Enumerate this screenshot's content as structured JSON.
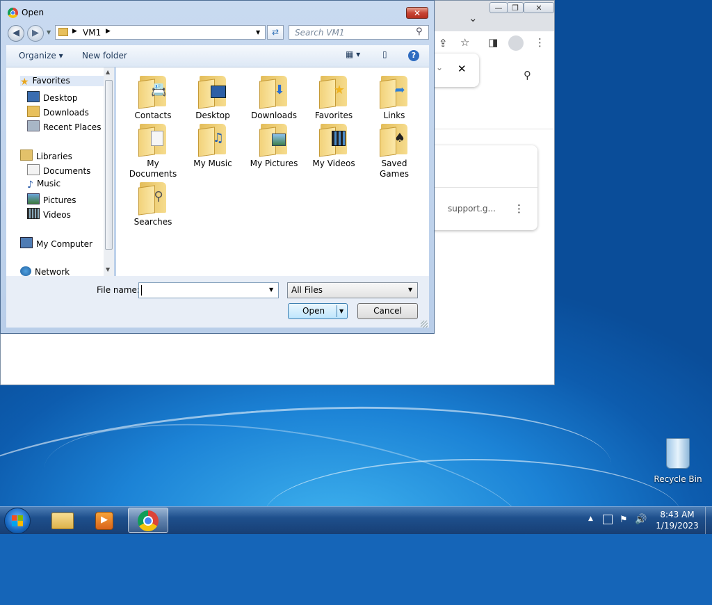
{
  "dialog": {
    "title": "Open",
    "close_glyph": "✕",
    "address_path": "VM1",
    "search_placeholder": "Search VM1",
    "toolbar": {
      "organize": "Organize",
      "new_folder": "New folder",
      "help": "?"
    },
    "nav": {
      "favorites": "Favorites",
      "desktop": "Desktop",
      "downloads": "Downloads",
      "recent_places": "Recent Places",
      "libraries": "Libraries",
      "documents": "Documents",
      "music": "Music",
      "pictures": "Pictures",
      "videos": "Videos",
      "my_computer": "My Computer",
      "network": "Network"
    },
    "items": [
      {
        "label": "Contacts",
        "icon": "contacts-icon"
      },
      {
        "label": "Desktop",
        "icon": "desktop-icon"
      },
      {
        "label": "Downloads",
        "icon": "downloads-icon"
      },
      {
        "label": "Favorites",
        "icon": "star-icon"
      },
      {
        "label": "Links",
        "icon": "links-icon"
      },
      {
        "label": "My Documents",
        "icon": "documents-icon"
      },
      {
        "label": "My Music",
        "icon": "music-icon"
      },
      {
        "label": "My Pictures",
        "icon": "pictures-icon"
      },
      {
        "label": "My Videos",
        "icon": "videos-icon"
      },
      {
        "label": "Saved Games",
        "icon": "chess-icon"
      },
      {
        "label": "Searches",
        "icon": "magnifier-icon"
      }
    ],
    "file_name_label": "File name:",
    "file_name_value": "",
    "file_type": "All Files",
    "open_button": "Open",
    "cancel_button": "Cancel"
  },
  "browser": {
    "card_text": "support.g..."
  },
  "desktop": {
    "recycle_bin": "Recycle Bin"
  },
  "taskbar": {
    "time": "8:43 AM",
    "date": "1/19/2023"
  }
}
